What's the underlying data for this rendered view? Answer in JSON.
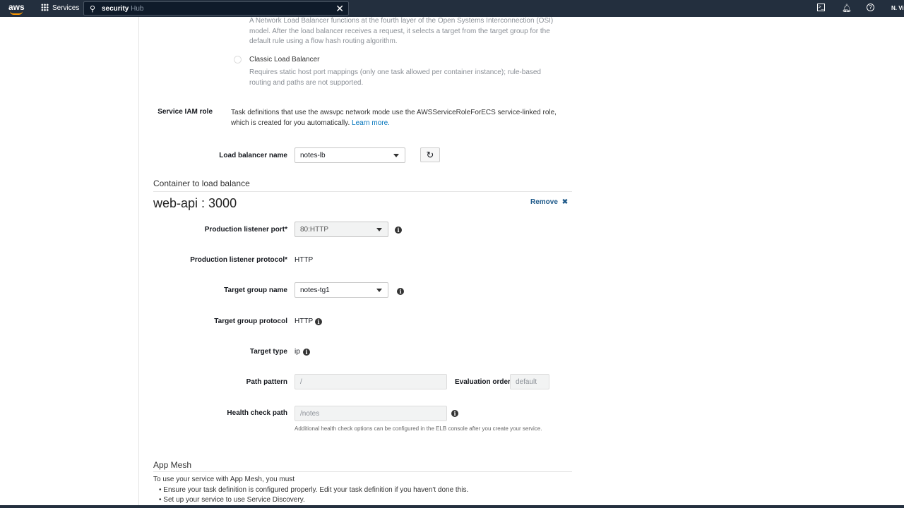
{
  "nav": {
    "logo": "aws",
    "services": "Services",
    "search_typed": "security",
    "search_suggest": " Hub",
    "user": "N. Vi"
  },
  "lb_options": {
    "nlb_desc": [
      "A Network Load Balancer functions at the fourth layer of the Open Systems Interconnection (OSI)",
      "model. After the load balancer receives a request, it selects a target from the target group for the",
      "default rule using a flow hash routing algorithm."
    ],
    "classic_label": "Classic Load Balancer",
    "classic_desc": [
      "Requires static host port mappings (only one task allowed per container instance); rule-based",
      "routing and paths are not supported."
    ]
  },
  "iam": {
    "label": "Service IAM role",
    "text1": "Task definitions that use the awsvpc network mode use the AWSServiceRoleForECS service-linked role,",
    "text2": "which is created for you automatically. ",
    "link": "Learn more."
  },
  "lb_name": {
    "label": "Load balancer name",
    "value": "notes-lb"
  },
  "container": {
    "section": "Container to load balance",
    "title": "web-api : 3000",
    "remove": "Remove",
    "port_label": "Production listener port*",
    "port_value": "80:HTTP",
    "proto_label": "Production listener protocol*",
    "proto_value": "HTTP",
    "tg_label": "Target group name",
    "tg_value": "notes-tg1",
    "tgp_label": "Target group protocol",
    "tgp_value": "HTTP",
    "tt_label": "Target type",
    "tt_value": "ip",
    "path_label": "Path pattern",
    "path_value": "/",
    "eval_label": "Evaluation order",
    "eval_value": "default",
    "hc_label": "Health check path",
    "hc_value": "/notes",
    "hc_note": "Additional health check options can be configured in the ELB console after you create your service."
  },
  "mesh": {
    "title": "App Mesh",
    "intro": "To use your service with App Mesh, you must",
    "bullets": [
      "Ensure your task definition is configured properly. Edit your task definition if you haven't done this.",
      "Set up your service to use Service Discovery."
    ]
  }
}
